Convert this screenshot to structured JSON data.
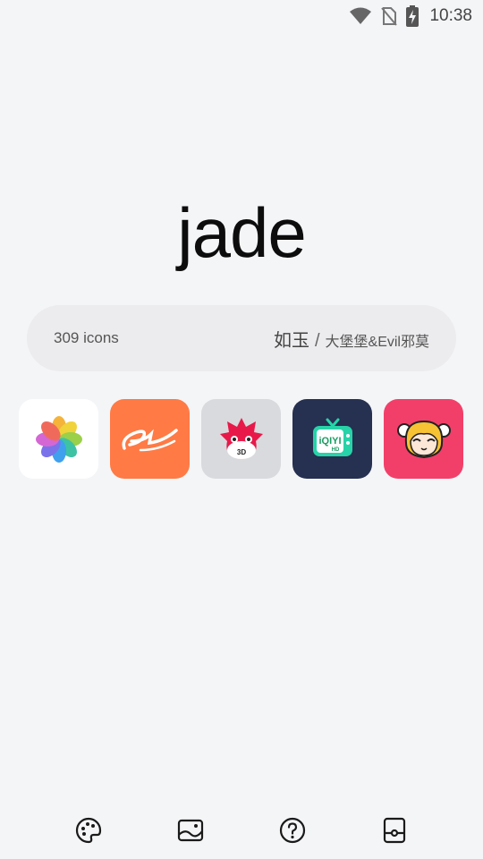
{
  "status_bar": {
    "time": "10:38",
    "icons": [
      "wifi-icon",
      "no-sim-icon",
      "battery-charging-icon"
    ]
  },
  "title": "jade",
  "info": {
    "icon_count": "309 icons",
    "author_primary": "如玉",
    "separator": "/",
    "author_secondary": "大堡堡&Evil邪莫"
  },
  "preview_icons": [
    {
      "name": "photos-pinwheel-icon",
      "bg": "#ffffff"
    },
    {
      "name": "alibaba-icon",
      "bg": "#ff7a45"
    },
    {
      "name": "antutu-3d-icon",
      "bg": "#d9dadd"
    },
    {
      "name": "iqiyi-hd-icon",
      "bg": "#263050"
    },
    {
      "name": "anime-girl-icon",
      "bg": "#f23f69"
    }
  ],
  "bottom_nav": [
    "palette-icon",
    "wallpaper-icon",
    "help-icon",
    "widget-icon"
  ],
  "colors": {
    "background": "#f4f5f7",
    "pill": "#ececee",
    "text": "#111111"
  }
}
